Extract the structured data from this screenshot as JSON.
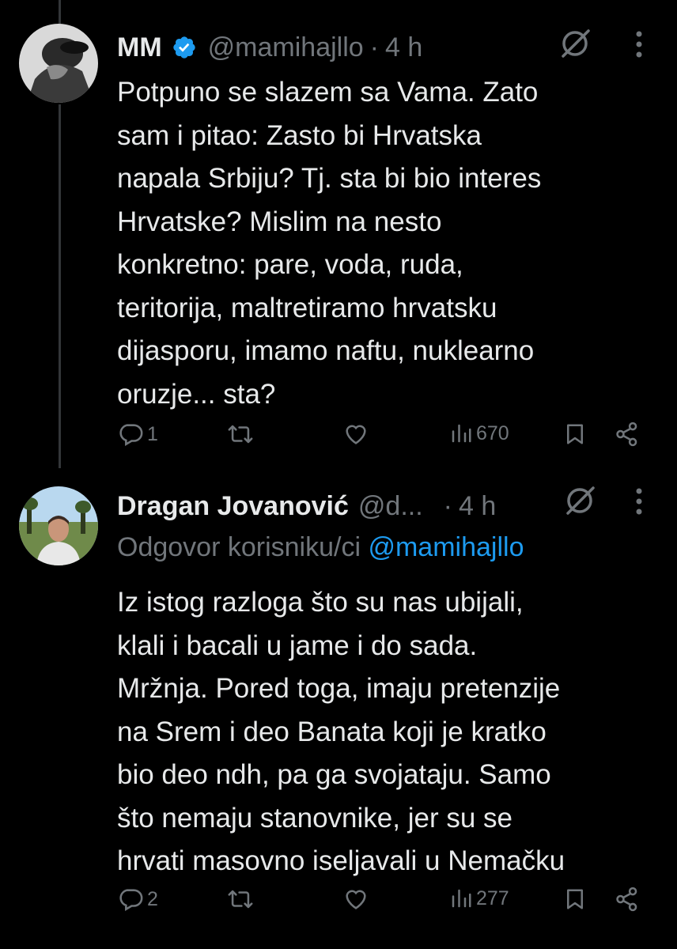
{
  "tweets": [
    {
      "name": "MM",
      "handle": "@mamihajllo",
      "separator": "·",
      "time": "4 h",
      "verified": true,
      "text": "Potpuno se slazem sa Vama. Zato\nsam i pitao: Zasto bi Hrvatska\nnapala Srbiju? Tj.  sta bi bio interes\nHrvatske? Mislim na nesto\nkonkretno: pare, voda, ruda,\nteritorija, maltretiramo hrvatsku\ndijasporu, imamo naftu, nuklearno\noruzje... sta?",
      "replies": "1",
      "views": "670"
    },
    {
      "name": "Dragan Jovanović",
      "handle": "@d...",
      "separator": "·",
      "time": "4 h",
      "verified": false,
      "reply_prefix": "Odgovor korisniku/ci",
      "reply_mention": "@mamihajllo",
      "text": "Iz istog razloga što su nas ubijali,\nklali i bacali u jame i do sada.\nMržnja. Pored toga, imaju pretenzije\nna Srem i deo Banata koji je kratko\nbio deo ndh, pa ga svojataju. Samo\nšto nemaju stanovnike, jer su se\nhrvati masovno iseljavali u Nemačku",
      "replies": "2",
      "views": "277"
    }
  ],
  "icons": {
    "verified": "verified-badge-icon",
    "grok": "grok-icon",
    "more": "more-icon",
    "reply": "reply-icon",
    "retweet": "retweet-icon",
    "like": "like-icon",
    "views": "views-icon",
    "bookmark": "bookmark-icon",
    "share": "share-icon"
  },
  "colors": {
    "background": "#000000",
    "text": "#e7e9ea",
    "muted": "#71767b",
    "accent": "#1d9bf0"
  }
}
